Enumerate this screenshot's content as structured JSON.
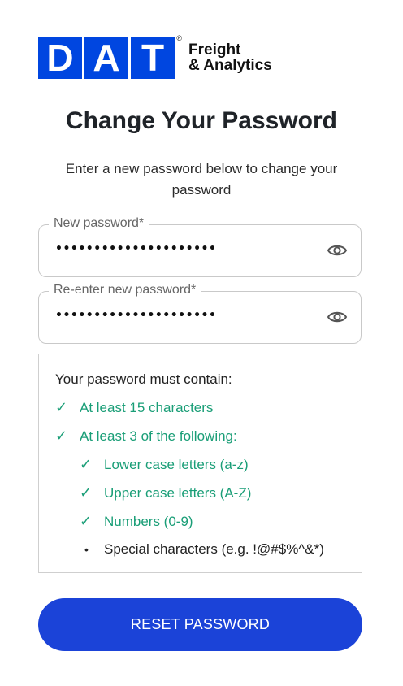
{
  "logo": {
    "letters": [
      "D",
      "A",
      "T"
    ],
    "registered": "®",
    "line1": "Freight",
    "line2": "& Analytics",
    "brand_color": "#0046e0"
  },
  "title": "Change Your Password",
  "subtitle": "Enter a new password below to change your password",
  "fields": [
    {
      "label": "New password*",
      "value": "•••••••••••••••••••••",
      "toggle_icon": "eye-icon"
    },
    {
      "label": "Re-enter new password*",
      "value": "•••••••••••••••••••••",
      "toggle_icon": "eye-icon"
    }
  ],
  "requirements": {
    "heading": "Your password must contain:",
    "items": [
      {
        "text": "At least 15 characters",
        "met": true,
        "mark": "✓"
      },
      {
        "text": "At least 3 of the following:",
        "met": true,
        "mark": "✓"
      },
      {
        "text": "Lower case letters (a-z)",
        "met": true,
        "mark": "✓"
      },
      {
        "text": "Upper case letters (A-Z)",
        "met": true,
        "mark": "✓"
      },
      {
        "text": "Numbers (0-9)",
        "met": true,
        "mark": "✓"
      },
      {
        "text": "Special characters (e.g. !@#$%^&*)",
        "met": false,
        "mark": "•"
      }
    ],
    "met_color": "#1a9e77"
  },
  "button": {
    "label": "RESET PASSWORD",
    "color": "#1b43d8"
  }
}
